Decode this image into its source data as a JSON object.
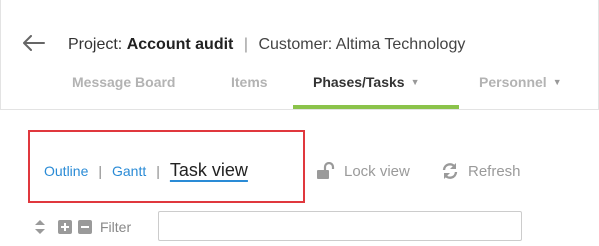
{
  "header": {
    "project_label": "Project:",
    "project_name": "Account audit",
    "separator": "|",
    "customer_label": "Customer: Altima Technology"
  },
  "tabs": [
    {
      "label": "Message Board",
      "active": false
    },
    {
      "label": "Items",
      "active": false
    },
    {
      "label": "Phases/Tasks",
      "active": true
    },
    {
      "label": "Personnel",
      "active": false
    }
  ],
  "views": {
    "outline": "Outline",
    "gantt": "Gantt",
    "task_view": "Task view",
    "sep": "|"
  },
  "toolbar": {
    "lock_view": "Lock view",
    "refresh": "Refresh"
  },
  "filter": {
    "label": "Filter",
    "value": ""
  },
  "colors": {
    "accent_link": "#2a8bd6",
    "active_tab_underline": "#8bc34a",
    "highlight_box": "#e0383e"
  }
}
